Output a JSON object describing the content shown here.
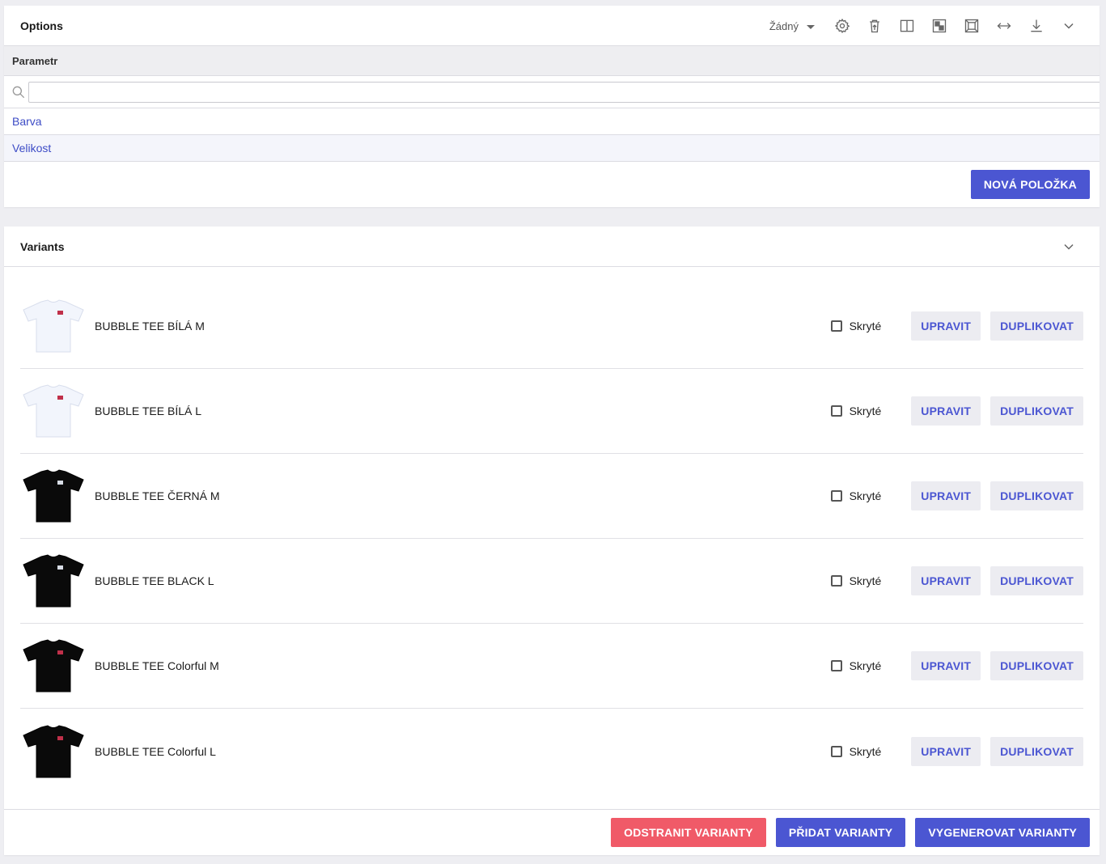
{
  "options": {
    "title": "Options",
    "dropdown_value": "Žádný",
    "column_header": "Parametr",
    "filter_value": "",
    "rows": [
      {
        "label": "Barva"
      },
      {
        "label": "Velikost"
      }
    ],
    "new_item_label": "NOVÁ POLOŽKA"
  },
  "variants": {
    "title": "Variants",
    "items": [
      {
        "name": "BUBBLE TEE BÍLÁ M",
        "hidden_label": "Skryté",
        "edit_label": "UPRAVIT",
        "duplicate_label": "DUPLIKOVAT",
        "shirt_color": "#f2f5fc",
        "print_color": "#c0304a"
      },
      {
        "name": "BUBBLE TEE BÍLÁ L",
        "hidden_label": "Skryté",
        "edit_label": "UPRAVIT",
        "duplicate_label": "DUPLIKOVAT",
        "shirt_color": "#f2f5fc",
        "print_color": "#c0304a"
      },
      {
        "name": "BUBBLE TEE ČERNÁ M",
        "hidden_label": "Skryté",
        "edit_label": "UPRAVIT",
        "duplicate_label": "DUPLIKOVAT",
        "shirt_color": "#0a0a0a",
        "print_color": "#d8dde6"
      },
      {
        "name": "BUBBLE TEE BLACK L",
        "hidden_label": "Skryté",
        "edit_label": "UPRAVIT",
        "duplicate_label": "DUPLIKOVAT",
        "shirt_color": "#0a0a0a",
        "print_color": "#d8dde6"
      },
      {
        "name": "BUBBLE TEE Colorful M",
        "hidden_label": "Skryté",
        "edit_label": "UPRAVIT",
        "duplicate_label": "DUPLIKOVAT",
        "shirt_color": "#0a0a0a",
        "print_color": "#c0304a"
      },
      {
        "name": "BUBBLE TEE Colorful L",
        "hidden_label": "Skryté",
        "edit_label": "UPRAVIT",
        "duplicate_label": "DUPLIKOVAT",
        "shirt_color": "#0a0a0a",
        "print_color": "#c0304a"
      }
    ],
    "footer": {
      "remove_label": "ODSTRANIT VARIANTY",
      "add_label": "PŘIDAT VARIANTY",
      "generate_label": "VYGENEROVAT VARIANTY"
    }
  },
  "colors": {
    "primary": "#4b56d2",
    "danger": "#f05a68",
    "link": "#3d4cc6"
  }
}
